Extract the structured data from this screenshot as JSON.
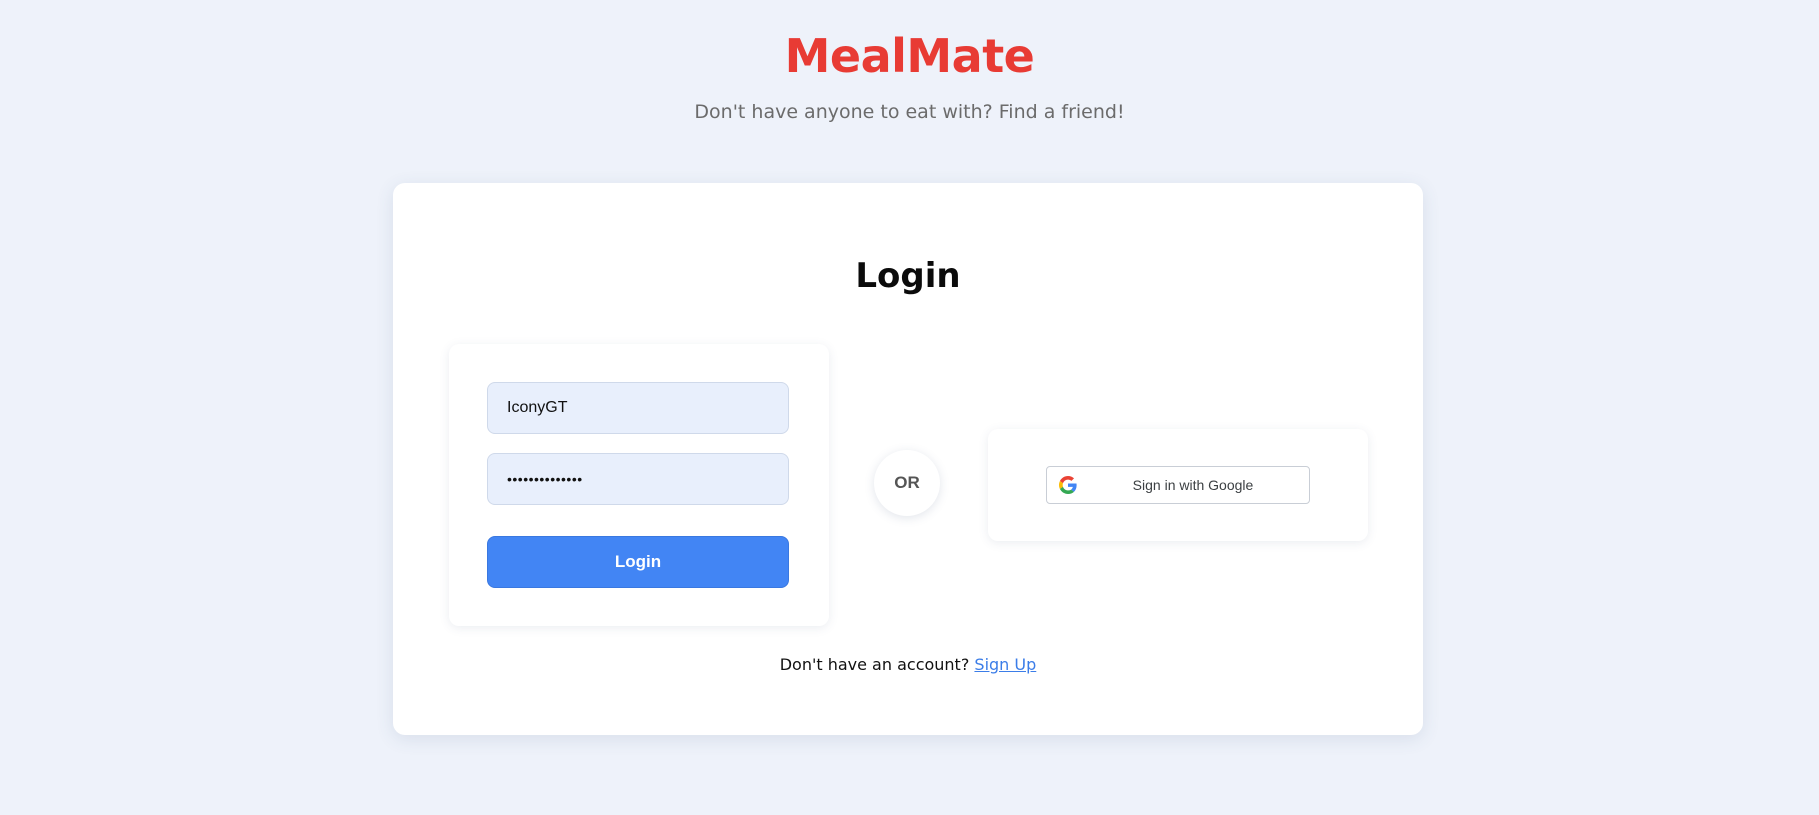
{
  "header": {
    "brand": "MealMate",
    "tagline": "Don't have anyone to eat with? Find a friend!"
  },
  "login_card": {
    "title": "Login",
    "form": {
      "username_value": "IconyGT",
      "password_masked": "••••••••••••••",
      "submit_label": "Login"
    },
    "divider_label": "OR",
    "google_button_label": "Sign in with Google",
    "signup_prompt": "Don't have an account?",
    "signup_link_label": "Sign Up"
  },
  "colors": {
    "brand": "#e83b34",
    "primary_button": "#4285f4",
    "background": "#eef2fa",
    "input_background": "#e8effc",
    "link": "#3b7de8"
  },
  "icons": {
    "google": "google-g-logo"
  }
}
